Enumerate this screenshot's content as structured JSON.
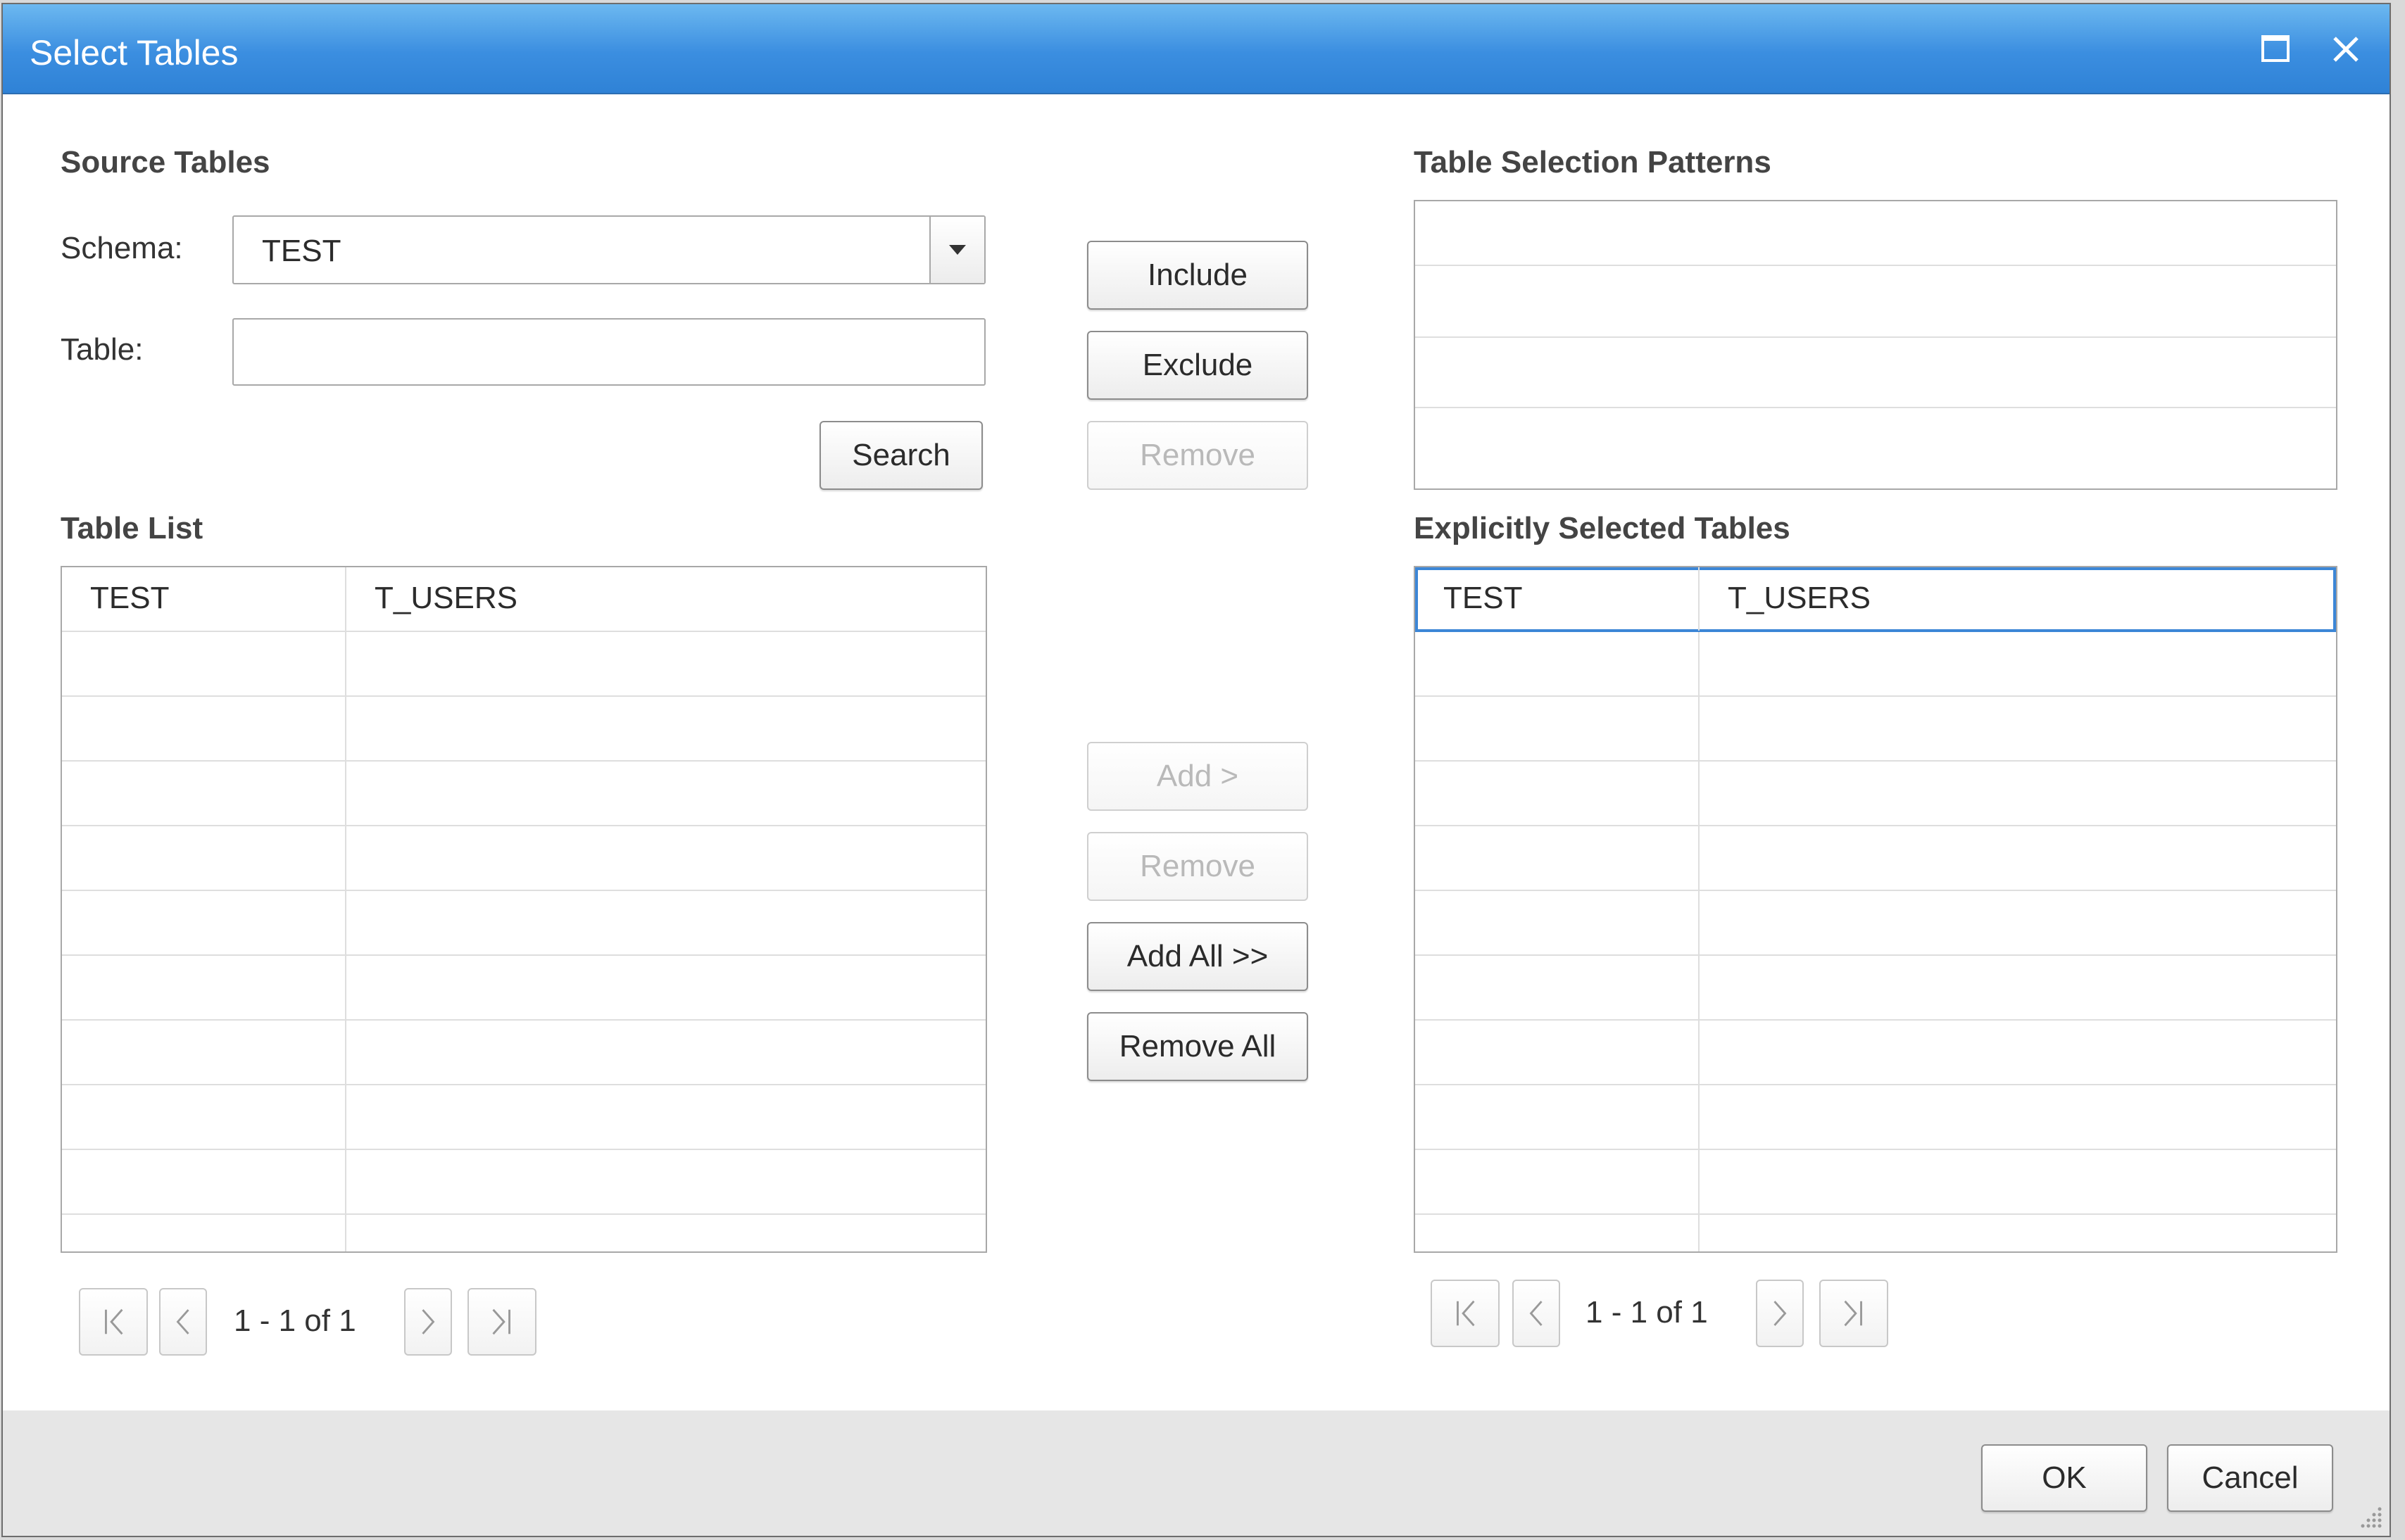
{
  "window": {
    "title": "Select Tables"
  },
  "source": {
    "heading": "Source Tables",
    "schema_label": "Schema:",
    "schema_value": "TEST",
    "table_label": "Table:",
    "table_value": "",
    "search_label": "Search"
  },
  "patterns": {
    "heading": "Table Selection Patterns",
    "include_label": "Include",
    "exclude_label": "Exclude",
    "remove_label": "Remove"
  },
  "table_list": {
    "heading": "Table List",
    "rows": [
      {
        "schema": "TEST",
        "table": "T_USERS"
      }
    ],
    "pager_text": "1 - 1 of 1"
  },
  "transfer": {
    "add_label": "Add >",
    "remove_label": "Remove",
    "add_all_label": "Add All >>",
    "remove_all_label": "Remove All"
  },
  "selected": {
    "heading": "Explicitly Selected Tables",
    "rows": [
      {
        "schema": "TEST",
        "table": "T_USERS"
      }
    ],
    "pager_text": "1 - 1 of 1"
  },
  "footer": {
    "ok_label": "OK",
    "cancel_label": "Cancel"
  },
  "icons": {
    "maximize": "maximize-icon",
    "close": "close-icon",
    "first": "first-page-icon",
    "prev": "previous-page-icon",
    "next": "next-page-icon",
    "last": "last-page-icon"
  },
  "colors": {
    "titlebar": "#3b8ee0",
    "selection_border": "#3c86d6"
  }
}
